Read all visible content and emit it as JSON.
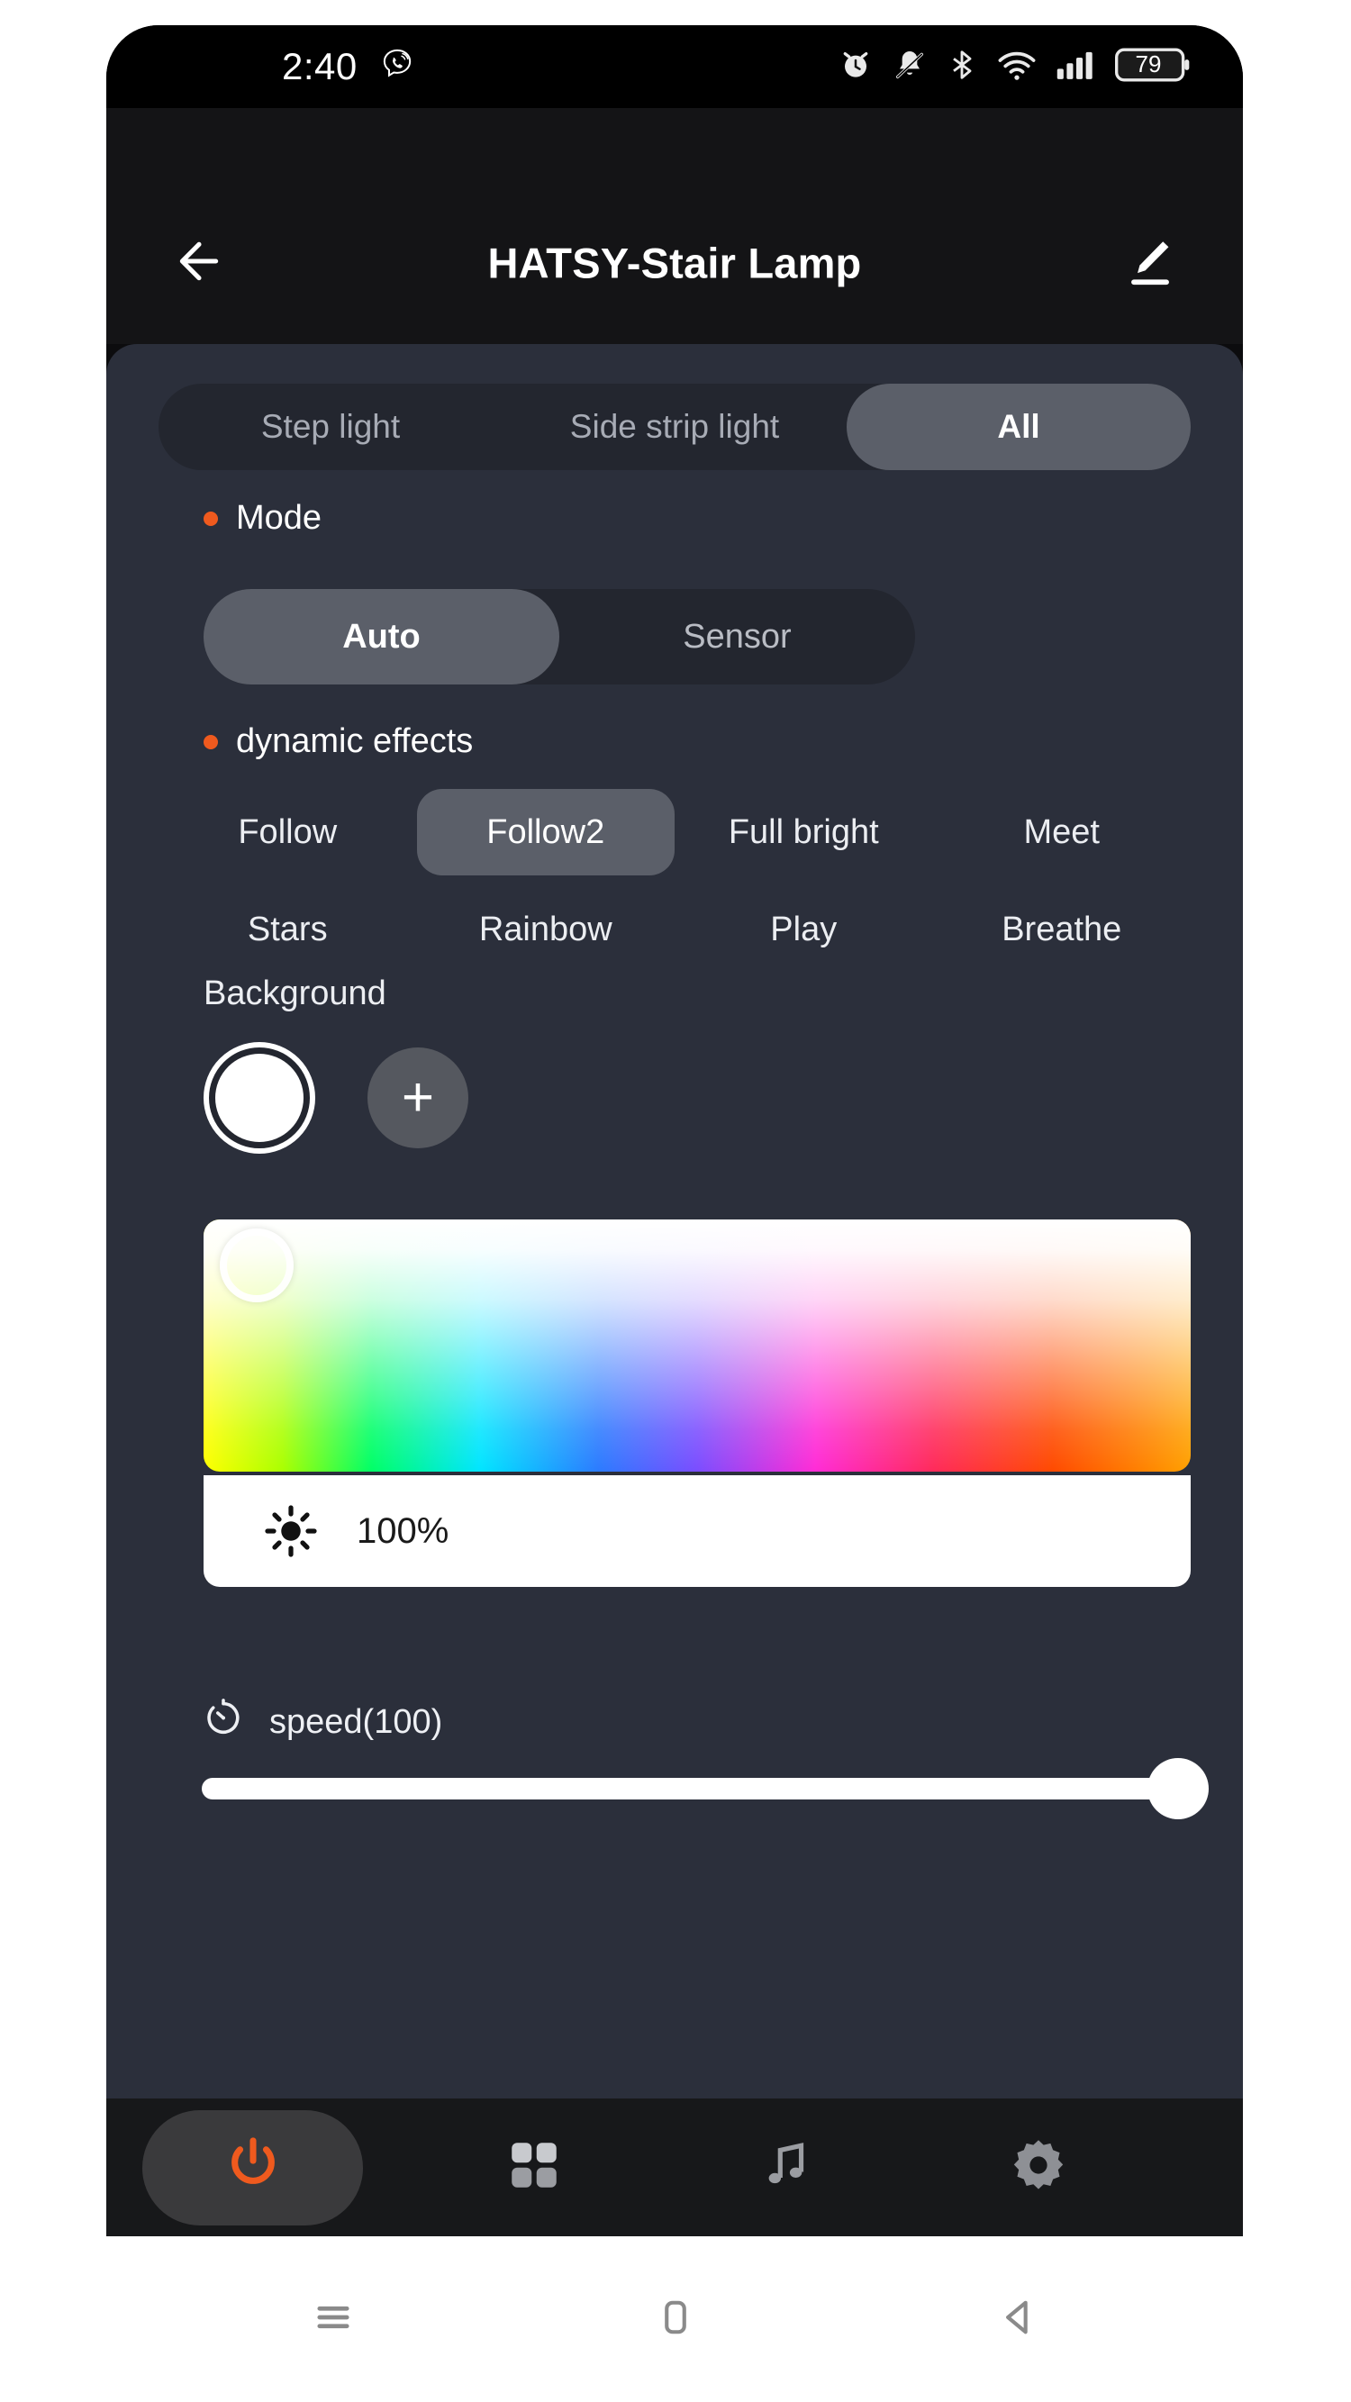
{
  "status_bar": {
    "time": "2:40",
    "battery_level": "79",
    "icons": [
      "viber-call-icon",
      "alarm-clock-icon",
      "bell-muted-icon",
      "bluetooth-icon",
      "wifi-icon",
      "cellular-signal-icon",
      "battery-icon"
    ]
  },
  "header": {
    "title": "HATSY-Stair Lamp",
    "back_icon": "back-arrow-icon",
    "edit_icon": "pencil-edit-icon"
  },
  "zone_tabs": {
    "items": [
      {
        "label": "Step light",
        "active": false
      },
      {
        "label": "Side strip light",
        "active": false
      },
      {
        "label": "All",
        "active": true
      }
    ]
  },
  "mode": {
    "label": "Mode",
    "options": [
      {
        "label": "Auto",
        "active": true
      },
      {
        "label": "Sensor",
        "active": false
      }
    ]
  },
  "dynamic_effects": {
    "label": "dynamic effects",
    "row1": [
      {
        "label": "Follow",
        "active": false
      },
      {
        "label": "Follow2",
        "active": true
      },
      {
        "label": "Full bright",
        "active": false
      },
      {
        "label": "Meet",
        "active": false
      }
    ],
    "row2": [
      {
        "label": "Stars",
        "active": false
      },
      {
        "label": "Rainbow",
        "active": false
      },
      {
        "label": "Play",
        "active": false
      },
      {
        "label": "Breathe",
        "active": false
      }
    ]
  },
  "background": {
    "label": "Background",
    "selected_swatch_color": "#ffffff",
    "add_label": "+"
  },
  "brightness": {
    "value": "100%",
    "icon": "sun-brightness-icon"
  },
  "speed": {
    "label": "speed(100)",
    "icon": "stopwatch-icon",
    "percent": 100
  },
  "bottom_nav": {
    "items": [
      {
        "name": "power-button",
        "icon": "power-icon",
        "active": true
      },
      {
        "name": "scenes-button",
        "icon": "grid-icon",
        "active": false
      },
      {
        "name": "music-button",
        "icon": "music-note-icon",
        "active": false
      },
      {
        "name": "settings-button",
        "icon": "gear-icon",
        "active": false
      }
    ]
  },
  "android_nav": {
    "items": [
      {
        "name": "recents-button",
        "icon": "hamburger-icon"
      },
      {
        "name": "home-button",
        "icon": "home-rounded-rect-icon"
      },
      {
        "name": "back-button",
        "icon": "back-triangle-icon"
      }
    ]
  },
  "colors": {
    "accent": "#ef5a1e",
    "panel_bg": "#2b2f3b",
    "pill_active": "#5b5f69",
    "pill_track": "#23262f"
  }
}
